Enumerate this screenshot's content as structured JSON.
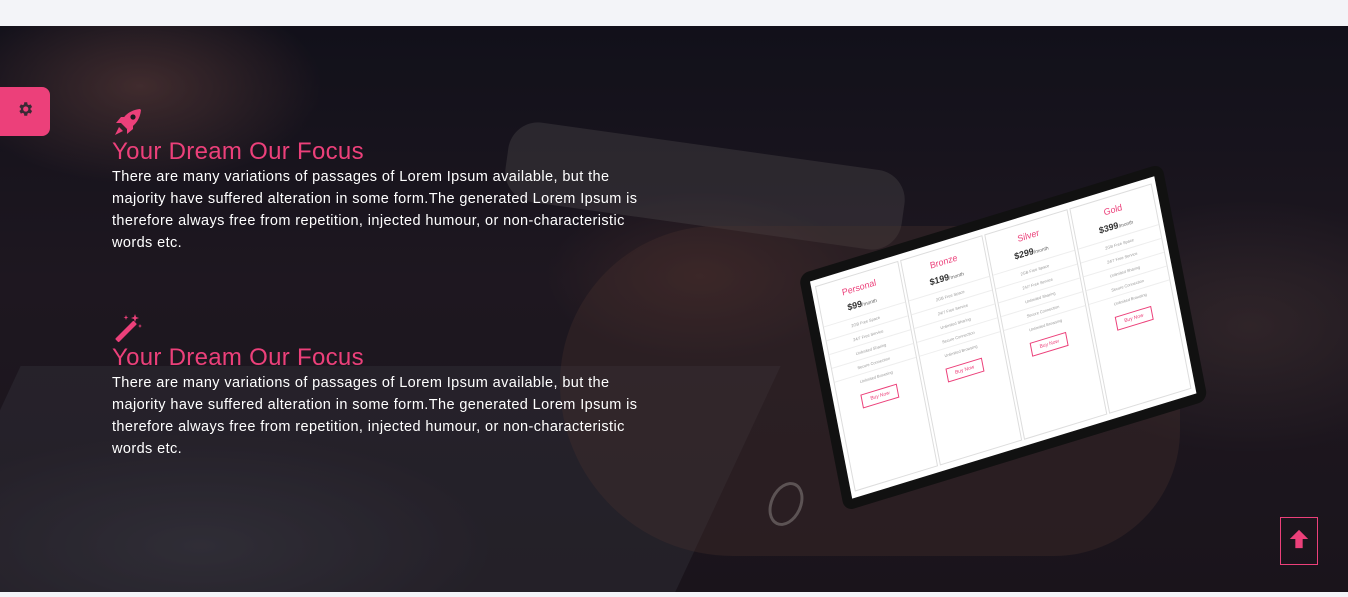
{
  "settings": {
    "icon": "gear-icon"
  },
  "features": [
    {
      "icon": "rocket-icon",
      "title": "Your Dream Our Focus",
      "text": "There are many variations of passages of Lorem Ipsum available, but the majority have suffered alteration in some form.The generated Lorem Ipsum is therefore always free from repetition, injected humour, or non-characteristic words etc."
    },
    {
      "icon": "magic-wand-icon",
      "title": "Your Dream Our Focus",
      "text": "There are many variations of passages of Lorem Ipsum available, but the majority have suffered alteration in some form.The generated Lorem Ipsum is therefore always free from repetition, injected humour, or non-characteristic words etc."
    }
  ],
  "tablet": {
    "plans": [
      {
        "name": "Personal",
        "price": "99",
        "period": "/month",
        "features": [
          "2GB Free Space",
          "24/7 Free Service",
          "Unlimited Sharing",
          "Secure Connection",
          "Unlimited Browsing"
        ],
        "button": "Buy Now"
      },
      {
        "name": "Bronze",
        "price": "199",
        "period": "/month",
        "features": [
          "2GB Free Space",
          "24/7 Free Service",
          "Unlimited Sharing",
          "Secure Connection",
          "Unlimited Browsing"
        ],
        "button": "Buy Now"
      },
      {
        "name": "Silver",
        "price": "299",
        "period": "/month",
        "features": [
          "2GB Free Space",
          "24/7 Free Service",
          "Unlimited Sharing",
          "Secure Connection",
          "Unlimited Browsing"
        ],
        "button": "Buy Now"
      },
      {
        "name": "Gold",
        "price": "399",
        "period": "/month",
        "features": [
          "2GB Free Space",
          "24/7 Free Service",
          "Unlimited Sharing",
          "Secure Connection",
          "Unlimited Browsing"
        ],
        "button": "Buy Now"
      }
    ]
  },
  "scroll_top": {
    "icon": "arrow-up-icon"
  },
  "colors": {
    "accent": "#ec407a",
    "text": "#ffffff",
    "page_bg": "#f3f4f8"
  }
}
